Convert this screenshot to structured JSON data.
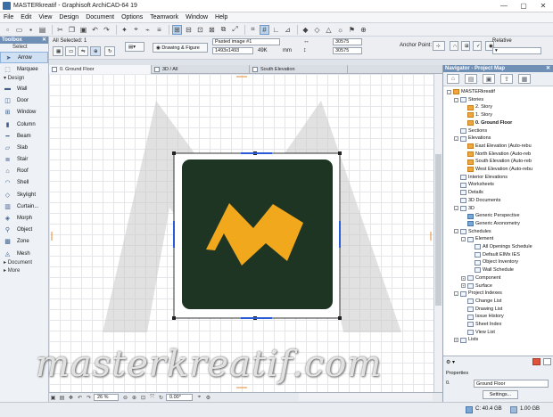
{
  "window": {
    "title": "MASTERkreatif - Graphisoft ArchiCAD-64 19",
    "min": "—",
    "max": "▢",
    "close": "✕"
  },
  "menu": [
    "File",
    "Edit",
    "View",
    "Design",
    "Document",
    "Options",
    "Teamwork",
    "Window",
    "Help"
  ],
  "infobox": {
    "selection": "All Selected: 1",
    "view_mode": "Drawing & Figure",
    "name": "Pasted image #1",
    "size": "1493x1493",
    "filesize": "49K",
    "unit": "mm",
    "x": "30575",
    "y": "30575",
    "anchor_label": "Anchor Point:",
    "relative": "Relative"
  },
  "toolbox": {
    "title": "Toolbox",
    "select_label": "Select",
    "tools_select": [
      {
        "label": "Arrow",
        "icon": "arrow-icon"
      },
      {
        "label": "Marquee",
        "icon": "marquee-icon"
      }
    ],
    "design_label": "Design",
    "tools_design": [
      {
        "label": "Wall",
        "icon": "wall-icon"
      },
      {
        "label": "Door",
        "icon": "door-icon"
      },
      {
        "label": "Window",
        "icon": "window-icon"
      },
      {
        "label": "Column",
        "icon": "column-icon"
      },
      {
        "label": "Beam",
        "icon": "beam-icon"
      },
      {
        "label": "Slab",
        "icon": "slab-icon"
      },
      {
        "label": "Stair",
        "icon": "stair-icon"
      },
      {
        "label": "Roof",
        "icon": "roof-icon"
      },
      {
        "label": "Shell",
        "icon": "shell-icon"
      },
      {
        "label": "Skylight",
        "icon": "skylight-icon"
      },
      {
        "label": "Curtain...",
        "icon": "curtain-wall-icon"
      },
      {
        "label": "Morph",
        "icon": "morph-icon"
      },
      {
        "label": "Object",
        "icon": "object-icon"
      },
      {
        "label": "Zone",
        "icon": "zone-icon"
      },
      {
        "label": "Mesh",
        "icon": "mesh-icon"
      }
    ],
    "document_label": "Document",
    "more_label": "More"
  },
  "tabs": [
    {
      "label": "0. Ground Floor",
      "active": true
    },
    {
      "label": "3D / All",
      "active": false
    },
    {
      "label": "South Elevation",
      "active": false
    }
  ],
  "bottombar": {
    "zoom": "26 %",
    "angle": "0.00°"
  },
  "navigator": {
    "title": "Navigator - Project Map",
    "tree": [
      {
        "label": "MASTERkreatif",
        "level": 0,
        "toggle": "-",
        "icon": "orange"
      },
      {
        "label": "Stories",
        "level": 1,
        "toggle": "-",
        "icon": "plain"
      },
      {
        "label": "2. Story",
        "level": 2,
        "toggle": "",
        "icon": "orange"
      },
      {
        "label": "1. Story",
        "level": 2,
        "toggle": "",
        "icon": "orange"
      },
      {
        "label": "0. Ground Floor",
        "level": 2,
        "toggle": "",
        "icon": "orange",
        "bold": true
      },
      {
        "label": "Sections",
        "level": 1,
        "toggle": "",
        "icon": "plain"
      },
      {
        "label": "Elevations",
        "level": 1,
        "toggle": "-",
        "icon": "plain"
      },
      {
        "label": "East Elevation (Auto-rebu",
        "level": 2,
        "toggle": "",
        "icon": "orange"
      },
      {
        "label": "North Elevation (Auto-reb",
        "level": 2,
        "toggle": "",
        "icon": "orange"
      },
      {
        "label": "South Elevation (Auto-reb",
        "level": 2,
        "toggle": "",
        "icon": "orange"
      },
      {
        "label": "West Elevation (Auto-rebu",
        "level": 2,
        "toggle": "",
        "icon": "orange"
      },
      {
        "label": "Interior Elevations",
        "level": 1,
        "toggle": "",
        "icon": "plain"
      },
      {
        "label": "Worksheets",
        "level": 1,
        "toggle": "",
        "icon": "plain"
      },
      {
        "label": "Details",
        "level": 1,
        "toggle": "",
        "icon": "plain"
      },
      {
        "label": "3D Documents",
        "level": 1,
        "toggle": "",
        "icon": "plain"
      },
      {
        "label": "3D",
        "level": 1,
        "toggle": "-",
        "icon": "plain"
      },
      {
        "label": "Generic Perspective",
        "level": 2,
        "toggle": "",
        "icon": "blue"
      },
      {
        "label": "Generic Axonometry",
        "level": 2,
        "toggle": "",
        "icon": "blue"
      },
      {
        "label": "Schedules",
        "level": 1,
        "toggle": "-",
        "icon": "plain"
      },
      {
        "label": "Element",
        "level": 2,
        "toggle": "-",
        "icon": "plain"
      },
      {
        "label": "All Openings Schedule",
        "level": 3,
        "toggle": "",
        "icon": "plain"
      },
      {
        "label": "Default EIMx IES",
        "level": 3,
        "toggle": "",
        "icon": "plain"
      },
      {
        "label": "Object Inventory",
        "level": 3,
        "toggle": "",
        "icon": "plain"
      },
      {
        "label": "Wall Schedule",
        "level": 3,
        "toggle": "",
        "icon": "plain"
      },
      {
        "label": "Component",
        "level": 2,
        "toggle": "+",
        "icon": "plain"
      },
      {
        "label": "Surface",
        "level": 2,
        "toggle": "+",
        "icon": "plain"
      },
      {
        "label": "Project Indexes",
        "level": 1,
        "toggle": "-",
        "icon": "plain"
      },
      {
        "label": "Change List",
        "level": 2,
        "toggle": "",
        "icon": "plain"
      },
      {
        "label": "Drawing List",
        "level": 2,
        "toggle": "",
        "icon": "plain"
      },
      {
        "label": "Issue History",
        "level": 2,
        "toggle": "",
        "icon": "plain"
      },
      {
        "label": "Sheet Index",
        "level": 2,
        "toggle": "",
        "icon": "plain"
      },
      {
        "label": "View List",
        "level": 2,
        "toggle": "",
        "icon": "plain"
      },
      {
        "label": "Lists",
        "level": 1,
        "toggle": "+",
        "icon": "plain"
      }
    ],
    "properties_label": "Properties",
    "property_value": "Ground Floor",
    "settings_label": "Settings..."
  },
  "status": {
    "disk": "C: 40.4 GB",
    "memory": "1.00 GB"
  },
  "watermark": "masterkreatif.com",
  "colors": {
    "header_blue": "#6f8fb5",
    "logo_orange": "#f2a81d",
    "image_bg": "#1f3524"
  }
}
